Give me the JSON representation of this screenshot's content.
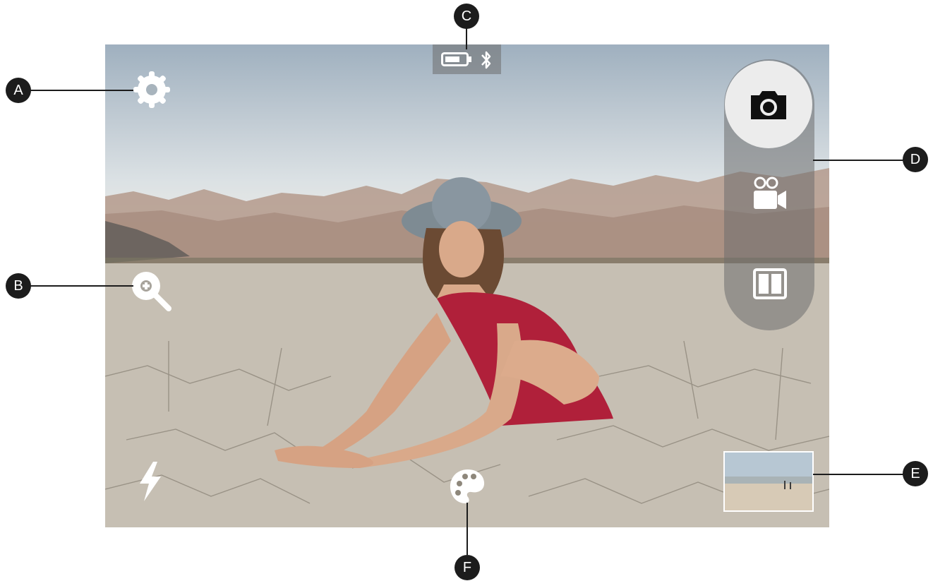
{
  "camera_ui": {
    "icons": {
      "settings": "gear-icon",
      "zoom": "zoom-in-icon",
      "battery": "battery-icon",
      "bluetooth": "bluetooth-icon",
      "photo_mode": "camera-icon",
      "video_mode": "video-camera-icon",
      "split_mode": "split-screen-icon",
      "flash": "flash-icon",
      "filters": "palette-icon",
      "gallery": "gallery-thumbnail"
    },
    "colors": {
      "callout": "#1c1c1c",
      "icon": "#ffffff",
      "overlay": "#6e6e6e",
      "active_mode_bg": "#ececec"
    }
  },
  "callouts": {
    "a": "A",
    "b": "B",
    "c": "C",
    "d": "D",
    "e": "E",
    "f": "F"
  }
}
